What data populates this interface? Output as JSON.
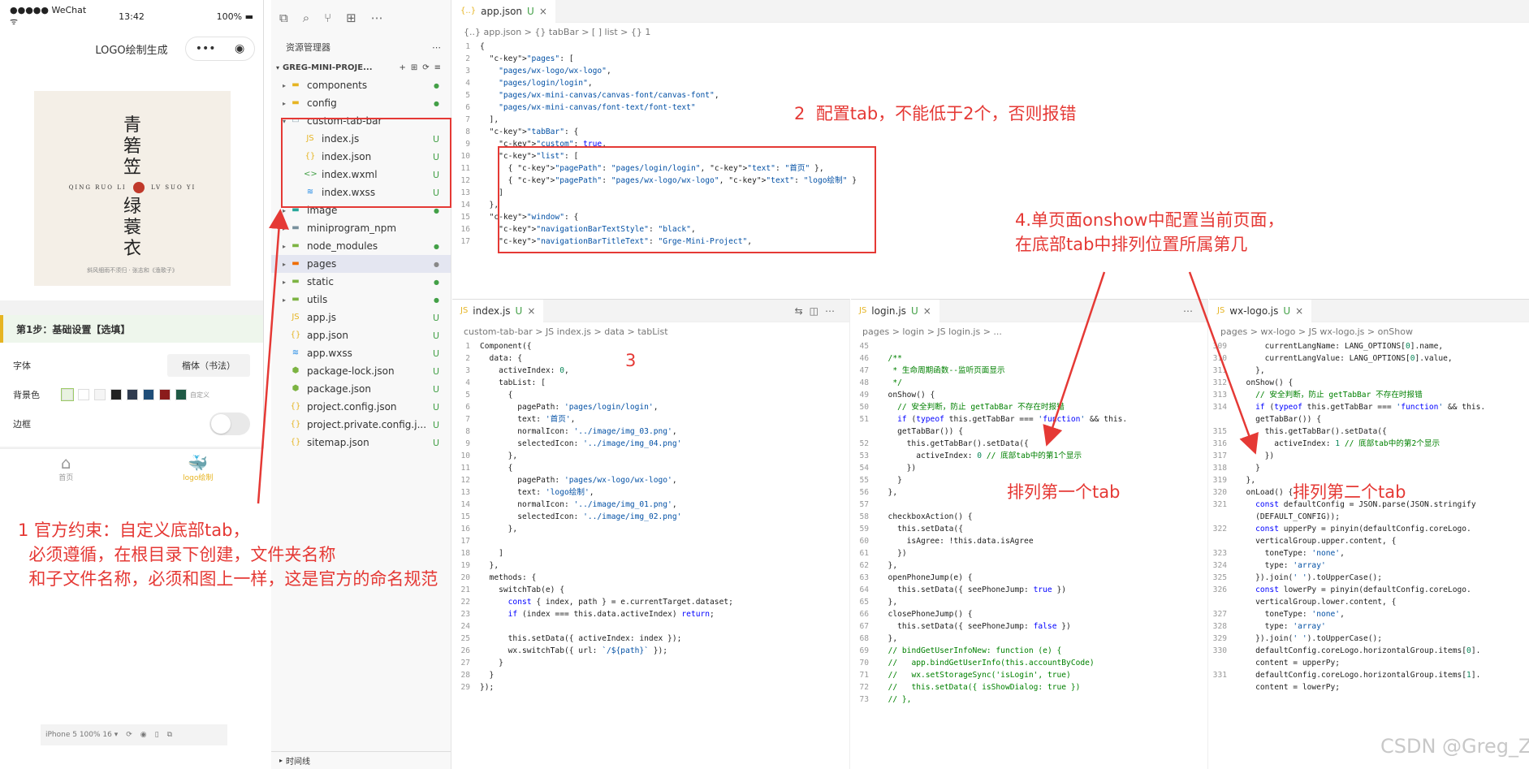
{
  "phone": {
    "status_left": "●●●●● WeChat ᯤ",
    "status_time": "13:42",
    "status_battery": "100% ▬",
    "nav_title": "LOGO绘制生成",
    "capsule_dots": "•••",
    "capsule_target": "◉",
    "logo_top": [
      "青",
      "箬",
      "笠"
    ],
    "logo_pinyin_left": "QING RUO LI",
    "logo_pinyin_right": "LV SUO YI",
    "logo_bottom": [
      "绿",
      "蓑",
      "衣"
    ],
    "logo_tagline": "斜风细雨不须归 · 张志和《渔歌子》",
    "step_title": "第1步：基础设置【选填】",
    "font_label": "字体",
    "font_value": "楷体（书法）",
    "bg_label": "背景色",
    "bg_colors": [
      "#e9f3e0",
      "#ffffff",
      "#f5f5f5",
      "#222222",
      "#2f3b4f",
      "#1f4e79",
      "#8b1c1c",
      "#1f5a46"
    ],
    "bg_custom": "自定义",
    "border_label": "边框",
    "tab_home": "首页",
    "tab_logo": "logo绘制",
    "sim_label": "iPhone 5 100% 16 ▾"
  },
  "explorer": {
    "title": "资源管理器",
    "project": "GREG-MINI-PROJE...",
    "items": [
      {
        "name": "components",
        "arrow": "▸",
        "type": "folder",
        "status": "●",
        "indent": 0
      },
      {
        "name": "config",
        "arrow": "▸",
        "type": "folder",
        "status": "●",
        "indent": 0
      },
      {
        "name": "custom-tab-bar",
        "arrow": "▾",
        "type": "folder-open",
        "status": "",
        "indent": 0
      },
      {
        "name": "index.js",
        "arrow": "",
        "type": "js",
        "status": "U",
        "indent": 1
      },
      {
        "name": "index.json",
        "arrow": "",
        "type": "json",
        "status": "U",
        "indent": 1
      },
      {
        "name": "index.wxml",
        "arrow": "",
        "type": "wxml",
        "status": "U",
        "indent": 1
      },
      {
        "name": "index.wxss",
        "arrow": "",
        "type": "wxss",
        "status": "U",
        "indent": 1
      },
      {
        "name": "image",
        "arrow": "▸",
        "type": "folder",
        "status": "●",
        "indent": 0
      },
      {
        "name": "miniprogram_npm",
        "arrow": "▸",
        "type": "folder",
        "status": "",
        "indent": 0
      },
      {
        "name": "node_modules",
        "arrow": "▸",
        "type": "folder",
        "status": "●",
        "indent": 0
      },
      {
        "name": "pages",
        "arrow": "▸",
        "type": "folder",
        "status": "●",
        "indent": 0,
        "selected": true
      },
      {
        "name": "static",
        "arrow": "▸",
        "type": "folder",
        "status": "●",
        "indent": 0
      },
      {
        "name": "utils",
        "arrow": "▸",
        "type": "folder",
        "status": "●",
        "indent": 0
      },
      {
        "name": "app.js",
        "arrow": "",
        "type": "js",
        "status": "U",
        "indent": 0
      },
      {
        "name": "app.json",
        "arrow": "",
        "type": "json",
        "status": "U",
        "indent": 0
      },
      {
        "name": "app.wxss",
        "arrow": "",
        "type": "wxss",
        "status": "U",
        "indent": 0
      },
      {
        "name": "package-lock.json",
        "arrow": "",
        "type": "pkg",
        "status": "U",
        "indent": 0
      },
      {
        "name": "package.json",
        "arrow": "",
        "type": "pkg",
        "status": "U",
        "indent": 0
      },
      {
        "name": "project.config.json",
        "arrow": "",
        "type": "json",
        "status": "U",
        "indent": 0
      },
      {
        "name": "project.private.config.j...",
        "arrow": "",
        "type": "json",
        "status": "U",
        "indent": 0
      },
      {
        "name": "sitemap.json",
        "arrow": "",
        "type": "json",
        "status": "U",
        "indent": 0
      }
    ],
    "timeline": "时间线"
  },
  "editors": {
    "app": {
      "tab": "app.json",
      "status": "U",
      "breadcrumb": "{..} app.json > {} tabBar > [ ] list > {} 1",
      "lines": [
        {
          "no": "1",
          "t": "{"
        },
        {
          "no": "2",
          "t": "  \"pages\": ["
        },
        {
          "no": "3",
          "t": "    \"pages/wx-logo/wx-logo\","
        },
        {
          "no": "4",
          "t": "    \"pages/login/login\","
        },
        {
          "no": "5",
          "t": "    \"pages/wx-mini-canvas/canvas-font/canvas-font\","
        },
        {
          "no": "6",
          "t": "    \"pages/wx-mini-canvas/font-text/font-text\""
        },
        {
          "no": "7",
          "t": "  ],"
        },
        {
          "no": "8",
          "t": "  \"tabBar\": {"
        },
        {
          "no": "9",
          "t": "    \"custom\": true,"
        },
        {
          "no": "10",
          "t": "    \"list\": ["
        },
        {
          "no": "11",
          "t": "      { \"pagePath\": \"pages/login/login\", \"text\": \"首页\" },"
        },
        {
          "no": "12",
          "t": "      { \"pagePath\": \"pages/wx-logo/wx-logo\", \"text\": \"logo绘制\" }"
        },
        {
          "no": "13",
          "t": "    ]"
        },
        {
          "no": "14",
          "t": "  },"
        },
        {
          "no": "15",
          "t": "  \"window\": {"
        },
        {
          "no": "16",
          "t": "    \"navigationBarTextStyle\": \"black\","
        },
        {
          "no": "17",
          "t": "    \"navigationBarTitleText\": \"Grge-Mini-Project\","
        }
      ]
    },
    "index": {
      "tab": "index.js",
      "status": "U",
      "breadcrumb": "custom-tab-bar > JS index.js > data > tabList",
      "lines": [
        {
          "no": "1",
          "t": "Component({"
        },
        {
          "no": "2",
          "t": "  data: {"
        },
        {
          "no": "3",
          "t": "    activeIndex: 0,"
        },
        {
          "no": "4",
          "t": "    tabList: ["
        },
        {
          "no": "5",
          "t": "      {"
        },
        {
          "no": "6",
          "t": "        pagePath: 'pages/login/login',"
        },
        {
          "no": "7",
          "t": "        text: '首页',"
        },
        {
          "no": "8",
          "t": "        normalIcon: '../image/img_03.png',"
        },
        {
          "no": "9",
          "t": "        selectedIcon: '../image/img_04.png'"
        },
        {
          "no": "10",
          "t": "      },"
        },
        {
          "no": "11",
          "t": "      {"
        },
        {
          "no": "12",
          "t": "        pagePath: 'pages/wx-logo/wx-logo',"
        },
        {
          "no": "13",
          "t": "        text: 'logo绘制',"
        },
        {
          "no": "14",
          "t": "        normalIcon: '../image/img_01.png',"
        },
        {
          "no": "15",
          "t": "        selectedIcon: '../image/img_02.png'"
        },
        {
          "no": "16",
          "t": "      },"
        },
        {
          "no": "17",
          "t": ""
        },
        {
          "no": "18",
          "t": "    ]"
        },
        {
          "no": "19",
          "t": "  },"
        },
        {
          "no": "20",
          "t": "  methods: {"
        },
        {
          "no": "21",
          "t": "    switchTab(e) {"
        },
        {
          "no": "22",
          "t": "      const { index, path } = e.currentTarget.dataset;"
        },
        {
          "no": "23",
          "t": "      if (index === this.data.activeIndex) return;"
        },
        {
          "no": "24",
          "t": ""
        },
        {
          "no": "25",
          "t": "      this.setData({ activeIndex: index });"
        },
        {
          "no": "26",
          "t": "      wx.switchTab({ url: `/${path}` });"
        },
        {
          "no": "27",
          "t": "    }"
        },
        {
          "no": "28",
          "t": "  }"
        },
        {
          "no": "29",
          "t": "});"
        }
      ]
    },
    "login": {
      "tab": "login.js",
      "status": "U",
      "breadcrumb": "pages > login > JS login.js > ...",
      "lines": [
        {
          "no": "45",
          "t": ""
        },
        {
          "no": "46",
          "t": "  /**"
        },
        {
          "no": "47",
          "t": "   * 生命周期函数--监听页面显示"
        },
        {
          "no": "48",
          "t": "   */"
        },
        {
          "no": "49",
          "t": "  onShow() {"
        },
        {
          "no": "50",
          "t": "    // 安全判断，防止 getTabBar 不存在时报错"
        },
        {
          "no": "51",
          "t": "    if (typeof this.getTabBar === 'function' && this."
        },
        {
          "no": "",
          "t": "    getTabBar()) {"
        },
        {
          "no": "52",
          "t": "      this.getTabBar().setData({"
        },
        {
          "no": "53",
          "t": "        activeIndex: 0 // 底部tab中的第1个显示"
        },
        {
          "no": "54",
          "t": "      })"
        },
        {
          "no": "55",
          "t": "    }"
        },
        {
          "no": "56",
          "t": "  },"
        },
        {
          "no": "57",
          "t": ""
        },
        {
          "no": "58",
          "t": "  checkboxAction() {"
        },
        {
          "no": "59",
          "t": "    this.setData({"
        },
        {
          "no": "60",
          "t": "      isAgree: !this.data.isAgree"
        },
        {
          "no": "61",
          "t": "    })"
        },
        {
          "no": "62",
          "t": "  },"
        },
        {
          "no": "63",
          "t": "  openPhoneJump(e) {"
        },
        {
          "no": "64",
          "t": "    this.setData({ seePhoneJump: true })"
        },
        {
          "no": "65",
          "t": "  },"
        },
        {
          "no": "66",
          "t": "  closePhoneJump() {"
        },
        {
          "no": "67",
          "t": "    this.setData({ seePhoneJump: false })"
        },
        {
          "no": "68",
          "t": "  },"
        },
        {
          "no": "69",
          "t": "  // bindGetUserInfoNew: function (e) {"
        },
        {
          "no": "70",
          "t": "  //   app.bindGetUserInfo(this.accountByCode)"
        },
        {
          "no": "71",
          "t": "  //   wx.setStorageSync('isLogin', true)"
        },
        {
          "no": "72",
          "t": "  //   this.setData({ isShowDialog: true })"
        },
        {
          "no": "73",
          "t": "  // },"
        }
      ]
    },
    "wxlogo": {
      "tab": "wx-logo.js",
      "status": "U",
      "breadcrumb": "pages > wx-logo > JS wx-logo.js > onShow",
      "lines": [
        {
          "no": "309",
          "t": "      currentLangName: LANG_OPTIONS[0].name,"
        },
        {
          "no": "310",
          "t": "      currentLangValue: LANG_OPTIONS[0].value,"
        },
        {
          "no": "311",
          "t": "    },"
        },
        {
          "no": "312",
          "t": "  onShow() {"
        },
        {
          "no": "313",
          "t": "    // 安全判断，防止 getTabBar 不存在时报错"
        },
        {
          "no": "314",
          "t": "    if (typeof this.getTabBar === 'function' && this."
        },
        {
          "no": "",
          "t": "    getTabBar()) {"
        },
        {
          "no": "315",
          "t": "      this.getTabBar().setData({"
        },
        {
          "no": "316",
          "t": "        activeIndex: 1 // 底部tab中的第2个显示"
        },
        {
          "no": "317",
          "t": "      })"
        },
        {
          "no": "318",
          "t": "    }"
        },
        {
          "no": "319",
          "t": "  },"
        },
        {
          "no": "320",
          "t": "  onLoad() {"
        },
        {
          "no": "321",
          "t": "    const defaultConfig = JSON.parse(JSON.stringify"
        },
        {
          "no": "",
          "t": "    (DEFAULT_CONFIG));"
        },
        {
          "no": "322",
          "t": "    const upperPy = pinyin(defaultConfig.coreLogo."
        },
        {
          "no": "",
          "t": "    verticalGroup.upper.content, {"
        },
        {
          "no": "323",
          "t": "      toneType: 'none',"
        },
        {
          "no": "324",
          "t": "      type: 'array'"
        },
        {
          "no": "325",
          "t": "    }).join(' ').toUpperCase();"
        },
        {
          "no": "326",
          "t": "    const lowerPy = pinyin(defaultConfig.coreLogo."
        },
        {
          "no": "",
          "t": "    verticalGroup.lower.content, {"
        },
        {
          "no": "327",
          "t": "      toneType: 'none',"
        },
        {
          "no": "328",
          "t": "      type: 'array'"
        },
        {
          "no": "329",
          "t": "    }).join(' ').toUpperCase();"
        },
        {
          "no": "330",
          "t": "    defaultConfig.coreLogo.horizontalGroup.items[0]."
        },
        {
          "no": "",
          "t": "    content = upperPy;"
        },
        {
          "no": "331",
          "t": "    defaultConfig.coreLogo.horizontalGroup.items[1]."
        },
        {
          "no": "",
          "t": "    content = lowerPy;"
        }
      ]
    }
  },
  "annotations": {
    "a1": "1 官方约束：自定义底部tab，\n  必须遵循，在根目录下创建，文件夹名称\n  和子文件名称，必须和图上一样，这是官方的命名规范",
    "a2": "2  配置tab，不能低于2个，否则报错",
    "a3": "3",
    "a4": "4.单页面onshow中配置当前页面，\n在底部tab中排列位置所属第几",
    "a5": "排列第一个tab",
    "a6": "排列第二个tab",
    "watermark": "CSDN @Greg_Zhong"
  },
  "colors": {
    "annotation": "#e53935",
    "untracked": "#43a047",
    "accent": "#e6b422"
  }
}
